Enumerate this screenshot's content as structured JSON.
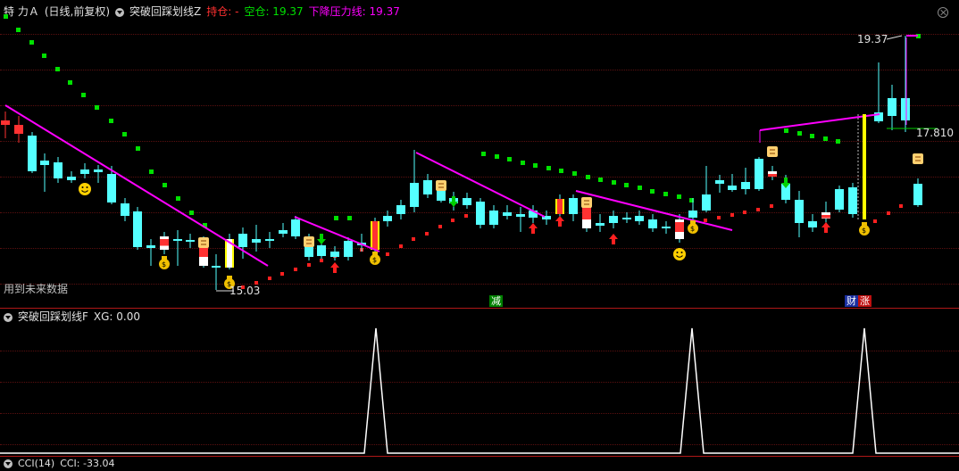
{
  "header": {
    "stock": "特 力Ａ",
    "period": "(日线,前复权)",
    "indicator1": "突破回踩划线Z",
    "hold_label": "持仓: -",
    "empty_label": "空仓: 19.37",
    "resist_label": "下降压力线: 19.37"
  },
  "sub_header": {
    "indicator2": "突破回踩划线F",
    "xg_label": "XG: 0.00"
  },
  "bottom_header": {
    "cci_label": "CCI(14)",
    "cci_value": "CCI: -33.04"
  },
  "labels": {
    "future_data": "用到未来数据",
    "price_high": "19.37",
    "price_low": "15.03",
    "price_mid": "17.810",
    "tag_jian": "减",
    "tag_cai": "财",
    "tag_zhang": "涨"
  },
  "colors": {
    "up": "#ff3232",
    "down": "#54ffff",
    "magenta": "#ff00ff",
    "green_dot": "#00e000",
    "red_dot": "#ff2020",
    "yellow": "#ffff00"
  }
}
